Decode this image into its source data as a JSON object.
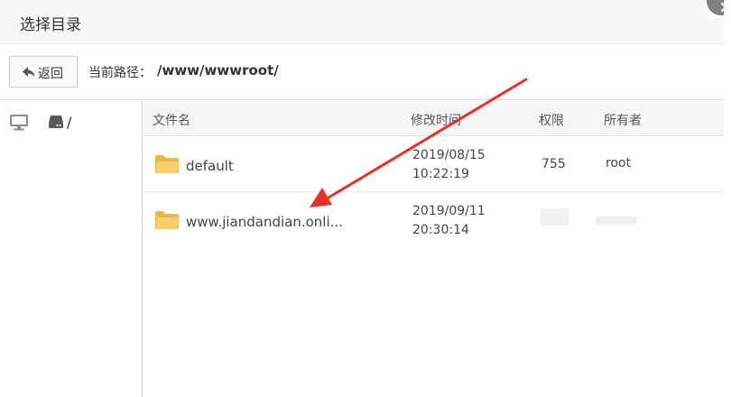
{
  "dialog": {
    "title": "选择目录"
  },
  "toolbar": {
    "back_label": "返回",
    "path_label": "当前路径：",
    "path_value": "/www/wwwroot/"
  },
  "sidebar": {
    "drive_label": "/"
  },
  "table": {
    "headers": {
      "name": "文件名",
      "mtime": "修改时间",
      "perm": "权限",
      "owner": "所有者"
    },
    "rows": [
      {
        "name": "default",
        "date": "2019/08/15",
        "time": "10:22:19",
        "perm": "755",
        "owner": "root"
      },
      {
        "name": "www.jiandandian.onli...",
        "date": "2019/09/11",
        "time": "20:30:14",
        "perm": "",
        "owner": ""
      }
    ]
  },
  "colors": {
    "folder": "#f5c85a",
    "arrow": "#e8302a",
    "close_button": "#808080"
  },
  "icons": {
    "back": "arrow-left-icon",
    "computer": "monitor-icon",
    "drive": "hard-drive-icon",
    "folder": "folder-icon",
    "close": "close-icon"
  }
}
